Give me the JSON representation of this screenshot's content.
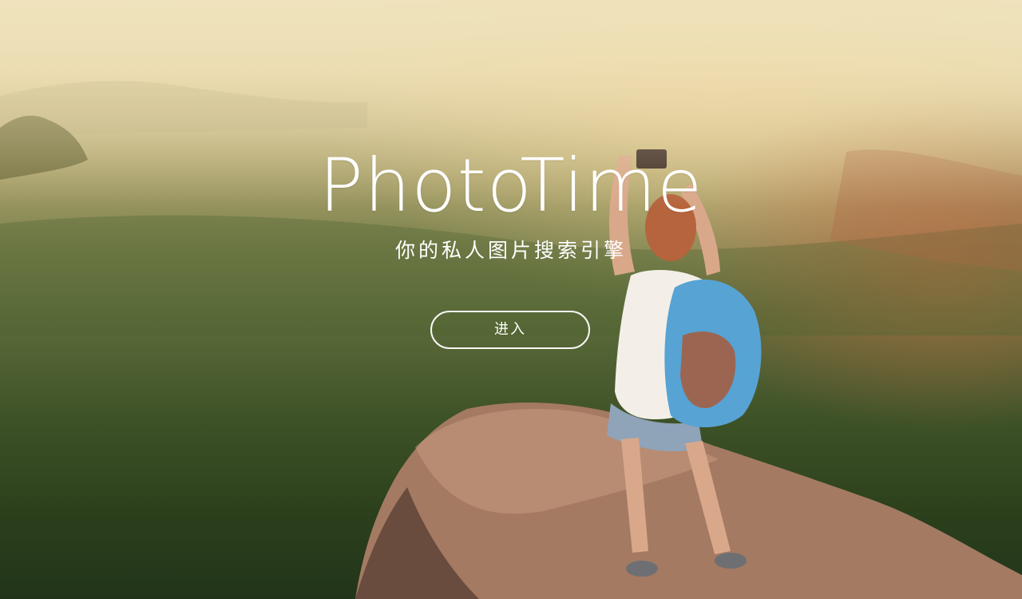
{
  "hero": {
    "title": "PhotoTime",
    "subtitle": "你的私人图片搜索引擎",
    "enter_label": "进入"
  },
  "colors": {
    "text": "#ffffff",
    "button_border": "#ffffff",
    "sky_haze": "#e9dcb0",
    "forest": "#2c401c",
    "sunset_glow": "#dc6e46"
  }
}
